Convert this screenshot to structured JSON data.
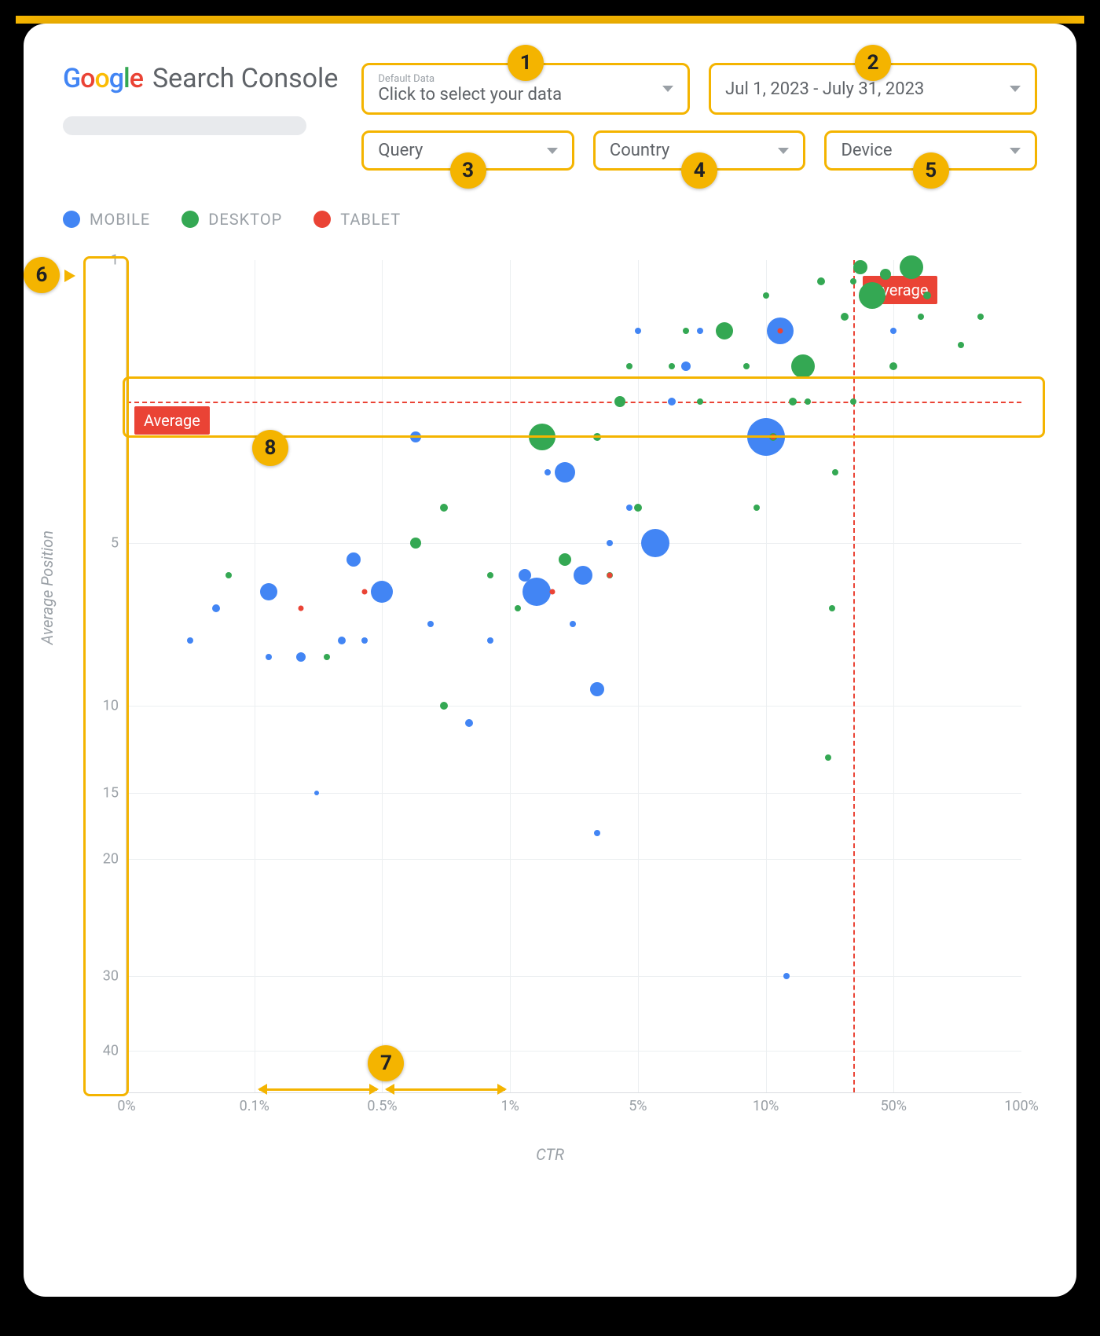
{
  "app": {
    "title": "Search Console",
    "logo_letters": [
      "G",
      "o",
      "o",
      "g",
      "l",
      "e"
    ]
  },
  "filters": {
    "data_selector": {
      "small": "Default Data",
      "main": "Click to select your data"
    },
    "date_range": {
      "label": "Jul 1, 2023 - July 31, 2023"
    },
    "query": {
      "label": "Query"
    },
    "country": {
      "label": "Country"
    },
    "device": {
      "label": "Device"
    }
  },
  "legend": [
    {
      "name": "MOBILE",
      "color": "#4285f4"
    },
    {
      "name": "DESKTOP",
      "color": "#34a853"
    },
    {
      "name": "TABLET",
      "color": "#ea4335"
    }
  ],
  "axes": {
    "x_label": "CTR",
    "y_label": "Average Position",
    "x_ticks": [
      "0%",
      "0.1%",
      "0.5%",
      "1%",
      "5%",
      "10%",
      "50%",
      "100%"
    ],
    "y_ticks": [
      "1",
      "5",
      "10",
      "15",
      "20",
      "30",
      "40"
    ]
  },
  "annotations": {
    "avg_label": "Average",
    "callouts": [
      "1",
      "2",
      "3",
      "4",
      "5",
      "6",
      "7",
      "8"
    ]
  },
  "chart_data": {
    "type": "scatter",
    "title": "",
    "xlabel": "CTR",
    "ylabel": "Average Position",
    "x_scale": "log",
    "x_ticks": [
      0,
      0.001,
      0.005,
      0.01,
      0.05,
      0.1,
      0.5,
      1.0
    ],
    "y_scale": "custom",
    "y_ticks": [
      1,
      5,
      10,
      15,
      20,
      30,
      40
    ],
    "average_ctr": 0.3,
    "average_position": 3.0,
    "size_encodes": "clicks (relative)",
    "series": [
      {
        "name": "MOBILE",
        "color": "#4285f4",
        "points": [
          {
            "ctr": 0.0007,
            "pos": 7.0,
            "size": 10
          },
          {
            "ctr": 0.0005,
            "pos": 8.0,
            "size": 8
          },
          {
            "ctr": 0.0012,
            "pos": 6.5,
            "size": 22
          },
          {
            "ctr": 0.0012,
            "pos": 8.5,
            "size": 8
          },
          {
            "ctr": 0.0018,
            "pos": 8.5,
            "size": 12
          },
          {
            "ctr": 0.0022,
            "pos": 15,
            "size": 6
          },
          {
            "ctr": 0.003,
            "pos": 8.0,
            "size": 10
          },
          {
            "ctr": 0.0035,
            "pos": 5.5,
            "size": 18
          },
          {
            "ctr": 0.004,
            "pos": 8.0,
            "size": 8
          },
          {
            "ctr": 0.005,
            "pos": 6.5,
            "size": 28
          },
          {
            "ctr": 0.006,
            "pos": 3.5,
            "size": 14
          },
          {
            "ctr": 0.0065,
            "pos": 7.5,
            "size": 8
          },
          {
            "ctr": 0.008,
            "pos": 11,
            "size": 10
          },
          {
            "ctr": 0.009,
            "pos": 8.0,
            "size": 8
          },
          {
            "ctr": 0.012,
            "pos": 6.0,
            "size": 16
          },
          {
            "ctr": 0.014,
            "pos": 6.5,
            "size": 36
          },
          {
            "ctr": 0.016,
            "pos": 4.0,
            "size": 8
          },
          {
            "ctr": 0.02,
            "pos": 4.0,
            "size": 26
          },
          {
            "ctr": 0.022,
            "pos": 7.5,
            "size": 8
          },
          {
            "ctr": 0.025,
            "pos": 6.0,
            "size": 24
          },
          {
            "ctr": 0.03,
            "pos": 18,
            "size": 8
          },
          {
            "ctr": 0.03,
            "pos": 9.5,
            "size": 18
          },
          {
            "ctr": 0.035,
            "pos": 5.0,
            "size": 8
          },
          {
            "ctr": 0.045,
            "pos": 4.5,
            "size": 8
          },
          {
            "ctr": 0.05,
            "pos": 2.0,
            "size": 8
          },
          {
            "ctr": 0.055,
            "pos": 5.0,
            "size": 36
          },
          {
            "ctr": 0.06,
            "pos": 3.0,
            "size": 10
          },
          {
            "ctr": 0.065,
            "pos": 2.5,
            "size": 12
          },
          {
            "ctr": 0.07,
            "pos": 2.0,
            "size": 8
          },
          {
            "ctr": 0.1,
            "pos": 3.5,
            "size": 48
          },
          {
            "ctr": 0.12,
            "pos": 2.0,
            "size": 34
          },
          {
            "ctr": 0.13,
            "pos": 30,
            "size": 8
          },
          {
            "ctr": 0.15,
            "pos": 2.5,
            "size": 10
          },
          {
            "ctr": 0.5,
            "pos": 2.0,
            "size": 8
          }
        ]
      },
      {
        "name": "DESKTOP",
        "color": "#34a853",
        "points": [
          {
            "ctr": 0.0008,
            "pos": 6.0,
            "size": 8
          },
          {
            "ctr": 0.0025,
            "pos": 8.5,
            "size": 8
          },
          {
            "ctr": 0.006,
            "pos": 5.0,
            "size": 14
          },
          {
            "ctr": 0.007,
            "pos": 4.5,
            "size": 10
          },
          {
            "ctr": 0.007,
            "pos": 10,
            "size": 10
          },
          {
            "ctr": 0.009,
            "pos": 6.0,
            "size": 8
          },
          {
            "ctr": 0.011,
            "pos": 7.0,
            "size": 8
          },
          {
            "ctr": 0.015,
            "pos": 3.5,
            "size": 34
          },
          {
            "ctr": 0.02,
            "pos": 5.5,
            "size": 16
          },
          {
            "ctr": 0.03,
            "pos": 3.5,
            "size": 10
          },
          {
            "ctr": 0.035,
            "pos": 6.0,
            "size": 8
          },
          {
            "ctr": 0.04,
            "pos": 3.0,
            "size": 14
          },
          {
            "ctr": 0.045,
            "pos": 2.5,
            "size": 8
          },
          {
            "ctr": 0.05,
            "pos": 4.5,
            "size": 10
          },
          {
            "ctr": 0.06,
            "pos": 2.5,
            "size": 8
          },
          {
            "ctr": 0.065,
            "pos": 2.0,
            "size": 8
          },
          {
            "ctr": 0.07,
            "pos": 3.0,
            "size": 8
          },
          {
            "ctr": 0.08,
            "pos": 2.0,
            "size": 22
          },
          {
            "ctr": 0.09,
            "pos": 2.5,
            "size": 8
          },
          {
            "ctr": 0.095,
            "pos": 4.5,
            "size": 8
          },
          {
            "ctr": 0.1,
            "pos": 1.5,
            "size": 8
          },
          {
            "ctr": 0.11,
            "pos": 3.5,
            "size": 10
          },
          {
            "ctr": 0.14,
            "pos": 3.0,
            "size": 10
          },
          {
            "ctr": 0.16,
            "pos": 2.5,
            "size": 30
          },
          {
            "ctr": 0.17,
            "pos": 3.0,
            "size": 8
          },
          {
            "ctr": 0.2,
            "pos": 1.3,
            "size": 10
          },
          {
            "ctr": 0.22,
            "pos": 13,
            "size": 8
          },
          {
            "ctr": 0.23,
            "pos": 7.0,
            "size": 8
          },
          {
            "ctr": 0.24,
            "pos": 4.0,
            "size": 8
          },
          {
            "ctr": 0.27,
            "pos": 1.8,
            "size": 10
          },
          {
            "ctr": 0.3,
            "pos": 1.3,
            "size": 8
          },
          {
            "ctr": 0.3,
            "pos": 3.0,
            "size": 8
          },
          {
            "ctr": 0.33,
            "pos": 1.1,
            "size": 18
          },
          {
            "ctr": 0.38,
            "pos": 1.5,
            "size": 34
          },
          {
            "ctr": 0.45,
            "pos": 1.2,
            "size": 14
          },
          {
            "ctr": 0.5,
            "pos": 2.5,
            "size": 10
          },
          {
            "ctr": 0.55,
            "pos": 1.1,
            "size": 30
          },
          {
            "ctr": 0.58,
            "pos": 1.8,
            "size": 8
          },
          {
            "ctr": 0.6,
            "pos": 1.5,
            "size": 10
          },
          {
            "ctr": 0.72,
            "pos": 2.2,
            "size": 8
          },
          {
            "ctr": 0.8,
            "pos": 1.8,
            "size": 8
          }
        ]
      },
      {
        "name": "TABLET",
        "color": "#ea4335",
        "points": [
          {
            "ctr": 0.0018,
            "pos": 7.0,
            "size": 7
          },
          {
            "ctr": 0.004,
            "pos": 6.5,
            "size": 7
          },
          {
            "ctr": 0.017,
            "pos": 6.5,
            "size": 7
          },
          {
            "ctr": 0.035,
            "pos": 6.0,
            "size": 7
          },
          {
            "ctr": 0.11,
            "pos": 3.5,
            "size": 7
          },
          {
            "ctr": 0.12,
            "pos": 2.0,
            "size": 7
          }
        ]
      }
    ]
  }
}
